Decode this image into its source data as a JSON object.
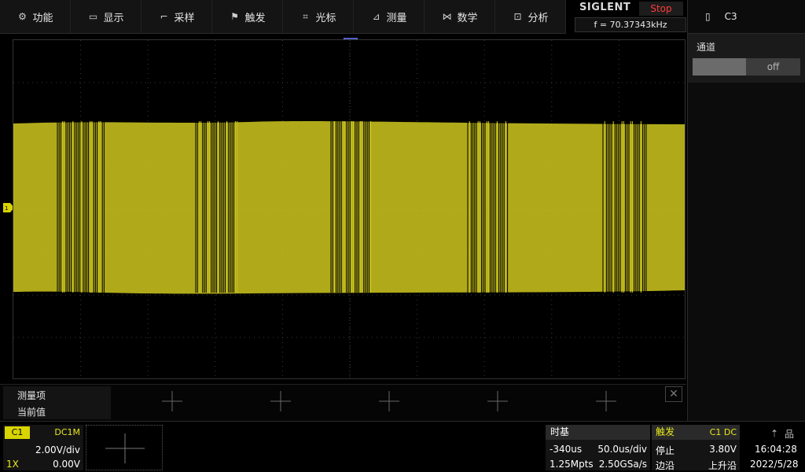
{
  "menu": [
    {
      "label": "功能",
      "icon": "gear-icon",
      "glyph": "⚙"
    },
    {
      "label": "显示",
      "icon": "monitor-icon",
      "glyph": "▭"
    },
    {
      "label": "采样",
      "icon": "sample-icon",
      "glyph": "⌐"
    },
    {
      "label": "触发",
      "icon": "flag-icon",
      "glyph": "⚑"
    },
    {
      "label": "光标",
      "icon": "cursor-icon",
      "glyph": "⌗"
    },
    {
      "label": "测量",
      "icon": "measure-icon",
      "glyph": "⊿"
    },
    {
      "label": "数学",
      "icon": "math-icon",
      "glyph": "⋈"
    },
    {
      "label": "分析",
      "icon": "analysis-icon",
      "glyph": "⊡"
    }
  ],
  "brand": "SIGLENT",
  "run_state": "Stop",
  "frequency": "f = 70.37343kHz",
  "right_panel": {
    "channel": "C3",
    "icon": "battery-icon",
    "section_label": "通道",
    "toggle_value": "off"
  },
  "measure": {
    "title": "测量项",
    "current": "当前值",
    "close": "✕"
  },
  "channel": {
    "tag": "C1",
    "coupling": "DC1M",
    "vdiv": "2.00V/div",
    "probe": "1X",
    "offset": "0.00V"
  },
  "timebase": {
    "title": "时基",
    "delay": "-340us",
    "tdiv": "50.0us/div",
    "points": "1.25Mpts",
    "sample_rate": "2.50GSa/s"
  },
  "trigger": {
    "title": "触发",
    "source": "C1 DC",
    "status": "停止",
    "level": "3.80V",
    "type": "边沿",
    "slope": "上升沿"
  },
  "clock": {
    "time": "16:04:28",
    "date": "2022/5/28"
  },
  "colors": {
    "trace": "#c8c21e",
    "channel1": "#d8d400",
    "stop": "#ff3a3a"
  }
}
